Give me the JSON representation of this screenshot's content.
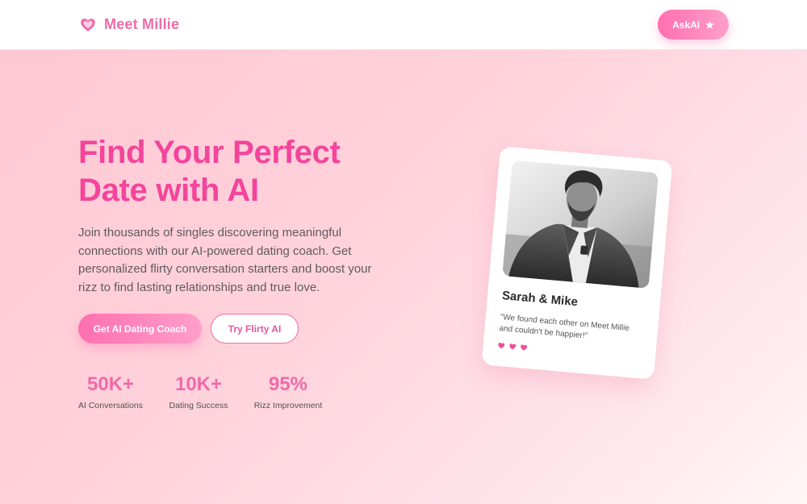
{
  "header": {
    "logo_text": "Meet Millie",
    "askai_label": "AskAI",
    "askai_icon": "star-icon"
  },
  "hero": {
    "title_line1": "Find Your Perfect",
    "title_line2": "Date with AI",
    "description": "Join thousands of singles discovering meaningful connections with our AI-powered dating coach. Get personalized flirty conversation starters and boost your rizz to find lasting relationships and true love.",
    "primary_button": "Get AI Dating Coach",
    "secondary_button": "Try Flirty AI"
  },
  "stats": [
    {
      "value": "50K+",
      "label": "AI Conversations"
    },
    {
      "value": "10K+",
      "label": "Dating Success"
    },
    {
      "value": "95%",
      "label": "Rizz Improvement"
    }
  ],
  "testimonial": {
    "names": "Sarah & Mike",
    "quote": "\"We found each other on Meet Millie and couldn't be happier!\"",
    "hearts": 3
  },
  "colors": {
    "brand": "#f4449c",
    "accent": "#f06aa8",
    "hero_bg_start": "#ffc8d3",
    "hero_bg_end": "#fff6f8"
  }
}
